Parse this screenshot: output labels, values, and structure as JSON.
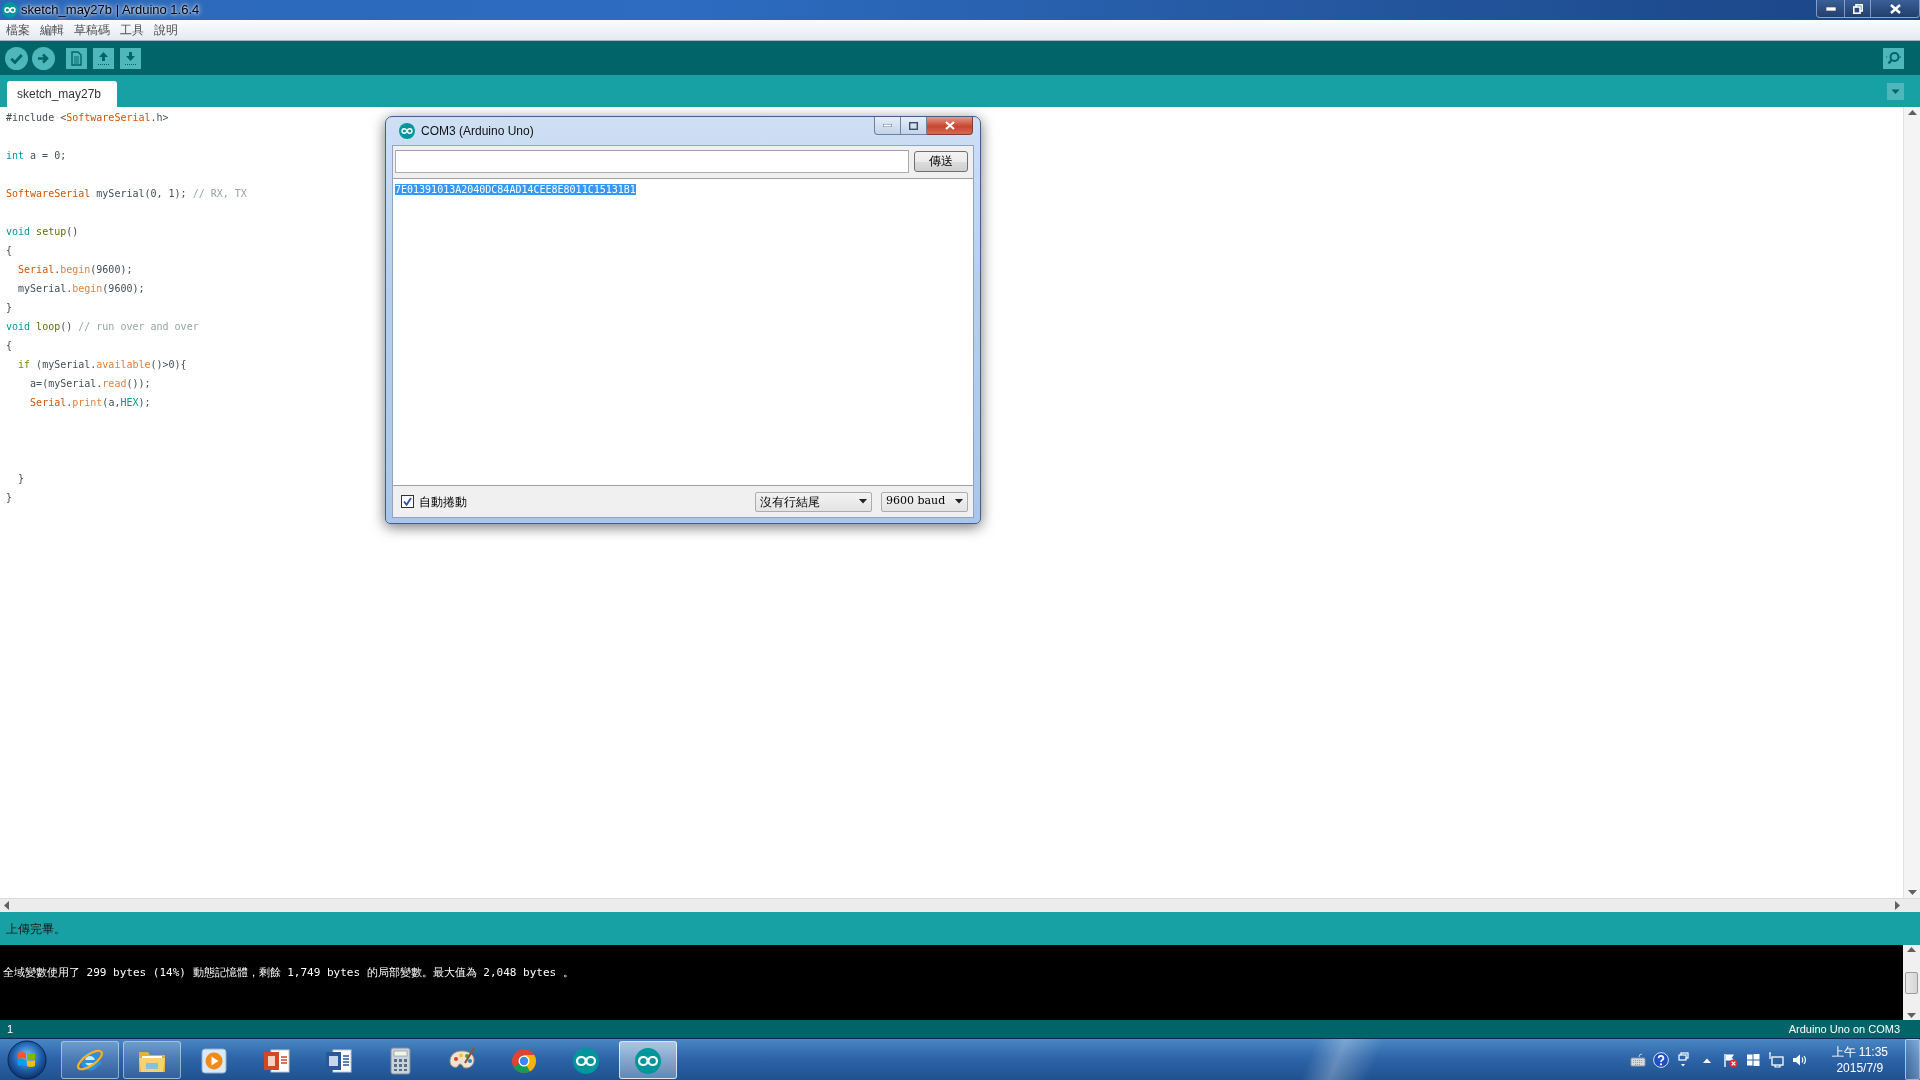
{
  "window": {
    "title": "sketch_may27b | Arduino 1.6.4"
  },
  "menu": [
    "檔案",
    "編輯",
    "草稿碼",
    "工具",
    "說明"
  ],
  "tabs": [
    {
      "label": "sketch_may27b",
      "selected": true
    }
  ],
  "editor": {
    "lines": [
      {
        "kind": "code",
        "tokens": [
          {
            "kind": "plain",
            "text": "#include <"
          },
          {
            "kind": "class",
            "text": "SoftwareSerial"
          },
          {
            "kind": "plain",
            "text": ".h>"
          }
        ]
      },
      {
        "kind": "blank"
      },
      {
        "kind": "code",
        "tokens": [
          {
            "kind": "type",
            "text": "int"
          },
          {
            "kind": "plain",
            "text": " a = 0;"
          }
        ]
      },
      {
        "kind": "blank"
      },
      {
        "kind": "code",
        "tokens": [
          {
            "kind": "class",
            "text": "SoftwareSerial"
          },
          {
            "kind": "plain",
            "text": " mySerial(0, 1); "
          },
          {
            "kind": "comment",
            "text": "// RX, TX"
          }
        ]
      },
      {
        "kind": "blank"
      },
      {
        "kind": "code",
        "tokens": [
          {
            "kind": "type",
            "text": "void "
          },
          {
            "kind": "function",
            "text": "setup"
          },
          {
            "kind": "plain",
            "text": "()"
          }
        ]
      },
      {
        "kind": "code",
        "tokens": [
          {
            "kind": "plain",
            "text": "{"
          }
        ]
      },
      {
        "kind": "code",
        "tokens": [
          {
            "kind": "class",
            "text": "  Serial"
          },
          {
            "kind": "plain",
            "text": "."
          },
          {
            "kind": "method",
            "text": "begin"
          },
          {
            "kind": "plain",
            "text": "(9600);"
          }
        ]
      },
      {
        "kind": "code",
        "tokens": [
          {
            "kind": "plain",
            "text": "  mySerial."
          },
          {
            "kind": "method",
            "text": "begin"
          },
          {
            "kind": "plain",
            "text": "(9600);"
          }
        ]
      },
      {
        "kind": "code",
        "tokens": [
          {
            "kind": "plain",
            "text": "}"
          }
        ]
      },
      {
        "kind": "code",
        "tokens": [
          {
            "kind": "type",
            "text": "void "
          },
          {
            "kind": "function",
            "text": "loop"
          },
          {
            "kind": "plain",
            "text": "() "
          },
          {
            "kind": "comment",
            "text": "// run over and over"
          }
        ]
      },
      {
        "kind": "code",
        "tokens": [
          {
            "kind": "plain",
            "text": "{"
          }
        ]
      },
      {
        "kind": "code",
        "tokens": [
          {
            "kind": "control",
            "text": "  if"
          },
          {
            "kind": "plain",
            "text": " (mySerial."
          },
          {
            "kind": "method",
            "text": "available"
          },
          {
            "kind": "plain",
            "text": "()>0){"
          }
        ]
      },
      {
        "kind": "code",
        "tokens": [
          {
            "kind": "plain",
            "text": "    a=(mySerial."
          },
          {
            "kind": "method",
            "text": "read"
          },
          {
            "kind": "plain",
            "text": "());"
          }
        ]
      },
      {
        "kind": "code",
        "tokens": [
          {
            "kind": "class",
            "text": "    Serial"
          },
          {
            "kind": "plain",
            "text": "."
          },
          {
            "kind": "method",
            "text": "print"
          },
          {
            "kind": "plain",
            "text": "(a,"
          },
          {
            "kind": "constant",
            "text": "HEX"
          },
          {
            "kind": "plain",
            "text": ");"
          }
        ]
      },
      {
        "kind": "blank"
      },
      {
        "kind": "blank"
      },
      {
        "kind": "blank"
      },
      {
        "kind": "code",
        "tokens": [
          {
            "kind": "plain",
            "text": "  }"
          }
        ]
      },
      {
        "kind": "code",
        "tokens": [
          {
            "kind": "plain",
            "text": "}"
          }
        ]
      }
    ]
  },
  "message_bar": {
    "text": "上傳完畢。"
  },
  "console": {
    "lines": [
      "全域變數使用了 299 bytes (14%) 動態記憶體，剩餘 1,749 bytes 的局部變數。最大值為 2,048 bytes 。"
    ]
  },
  "status_bar": {
    "line": "1",
    "board": "Arduino Uno on COM3"
  },
  "serial_monitor": {
    "title": "COM3 (Arduino Uno)",
    "send_button": "傳送",
    "output": [
      {
        "text": "7E01391013A2040DC84AD14CEE8E8011C15131B1",
        "selected": true
      }
    ],
    "autoscroll": {
      "label": "自動捲動",
      "checked": true
    },
    "line_ending": "沒有行結尾",
    "baud_rate": "9600 baud"
  },
  "taskbar": {
    "apps": [
      {
        "kind": "browser",
        "running": true,
        "selected": false
      },
      {
        "kind": "folder",
        "running": true,
        "selected": false
      },
      {
        "kind": "media",
        "running": false,
        "selected": false
      },
      {
        "kind": "presentation",
        "running": false,
        "selected": false
      },
      {
        "kind": "document",
        "running": false,
        "selected": false
      },
      {
        "kind": "calculator",
        "running": false,
        "selected": false
      },
      {
        "kind": "paint",
        "running": false,
        "selected": false
      },
      {
        "kind": "web",
        "running": false,
        "selected": false
      },
      {
        "kind": "arduino",
        "running": false,
        "selected": false
      },
      {
        "kind": "arduino",
        "running": true,
        "selected": true
      }
    ],
    "clock": {
      "time": "上午 11:35",
      "date": "2015/7/9"
    }
  }
}
